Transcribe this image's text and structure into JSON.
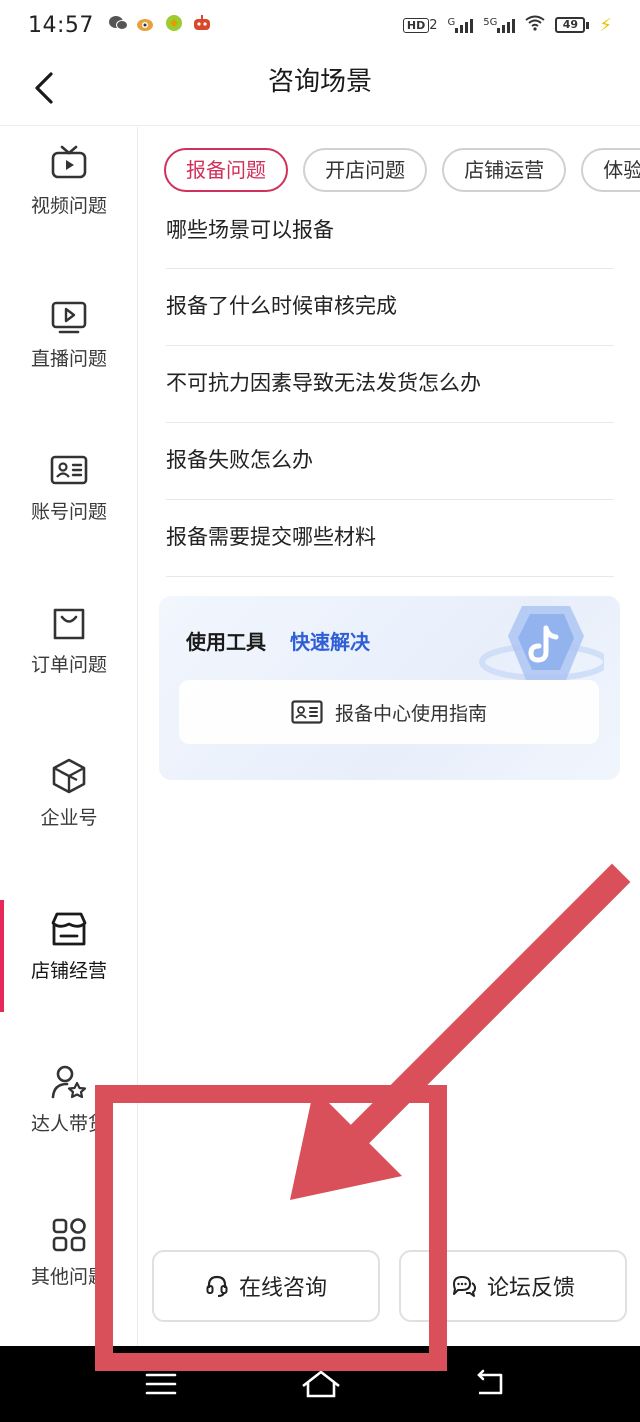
{
  "status_bar": {
    "time": "14:57",
    "hd_badge": "HD",
    "hd_sub": "2",
    "network_g": "G",
    "network_5g": "5G",
    "battery_level": "49",
    "battery_fraction": 0.49
  },
  "header": {
    "title": "咨询场景"
  },
  "sidebar": {
    "items": [
      {
        "label": "视频问题",
        "icon": "tv-icon"
      },
      {
        "label": "直播问题",
        "icon": "live-play-icon"
      },
      {
        "label": "账号问题",
        "icon": "id-card-icon"
      },
      {
        "label": "订单问题",
        "icon": "shopping-bag-icon"
      },
      {
        "label": "企业号",
        "icon": "enterprise-cube-icon"
      },
      {
        "label": "店铺经营",
        "icon": "storefront-icon"
      },
      {
        "label": "达人带货",
        "icon": "user-star-icon"
      },
      {
        "label": "其他问题",
        "icon": "grid-apps-icon"
      }
    ],
    "active_index": 5
  },
  "tabs": [
    {
      "label": "报备问题"
    },
    {
      "label": "开店问题"
    },
    {
      "label": "店铺运营"
    },
    {
      "label": "体验分"
    }
  ],
  "questions": [
    "哪些场景可以报备",
    "报备了什么时候审核完成",
    "不可抗力因素导致无法发货怎么办",
    "报备失败怎么办",
    "报备需要提交哪些材料"
  ],
  "tool_card": {
    "heading": "使用工具",
    "heading_accent": "快速解决",
    "guide_label": "报备中心使用指南",
    "accent_color": "#2f5fd6"
  },
  "actions": {
    "online_label": "在线咨询",
    "forum_label": "论坛反馈"
  },
  "colors": {
    "brand": "#e8285b",
    "tab_active": "#d0305c",
    "annotation": "#d9505a"
  }
}
